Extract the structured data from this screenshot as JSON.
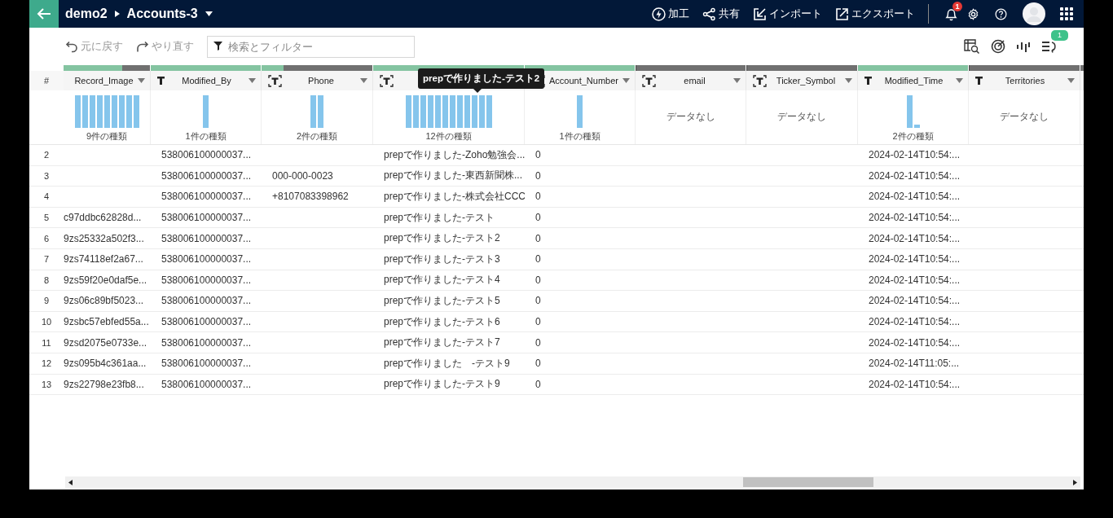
{
  "header": {
    "workspace": "demo2",
    "dataset": "Accounts-3",
    "actions": [
      {
        "kind": "bolt",
        "label": "加工"
      },
      {
        "kind": "share",
        "label": "共有"
      },
      {
        "kind": "import",
        "label": "インポート"
      },
      {
        "kind": "export",
        "label": "エクスポート"
      }
    ],
    "notification_count": "1"
  },
  "toolbar": {
    "undo": {
      "label": "元に戻す",
      "disabled": true
    },
    "redo": {
      "label": "やり直す",
      "disabled": true
    },
    "search": {
      "placeholder": "検索とフィルター"
    },
    "rules_count": "1"
  },
  "tooltip": "prepで作りました-テスト2",
  "table": {
    "number_header": "#",
    "columns": [
      {
        "label": "Record_Image",
        "kind": "none",
        "level": 0.68,
        "profile": {
          "kind": "histogram",
          "summary": "9件の種類",
          "bars": [
            {
              "kind": "tall"
            },
            {
              "kind": "tall"
            },
            {
              "kind": "tall"
            },
            {
              "kind": "tall"
            },
            {
              "kind": "tall"
            },
            {
              "kind": "tall"
            },
            {
              "kind": "tall"
            },
            {
              "kind": "tall"
            },
            {
              "kind": "tall"
            }
          ]
        }
      },
      {
        "label": "Modified_By",
        "kind": "plain",
        "level": 1,
        "profile": {
          "kind": "histogram",
          "summary": "1件の種類",
          "bars": [
            {
              "kind": "tall"
            }
          ]
        }
      },
      {
        "label": "Phone",
        "kind": "bracket",
        "level": 0.2,
        "profile": {
          "kind": "histogram",
          "summary": "2件の種類",
          "bars": [
            {
              "kind": "tall"
            },
            {
              "kind": "tall"
            }
          ]
        }
      },
      {
        "kind": "bracket",
        "level": 1,
        "profile": {
          "kind": "histogram",
          "summary": "12件の種類",
          "bars": [
            {
              "kind": "tall"
            },
            {
              "kind": "tall"
            },
            {
              "kind": "tall"
            },
            {
              "kind": "tall"
            },
            {
              "kind": "tall"
            },
            {
              "kind": "tall"
            },
            {
              "kind": "tall"
            },
            {
              "kind": "tall"
            },
            {
              "kind": "tall"
            },
            {
              "kind": "tall"
            },
            {
              "kind": "tall"
            },
            {
              "kind": "tall"
            }
          ]
        }
      },
      {
        "label": "Account_Number",
        "kind": "bracket",
        "level": 1,
        "profile": {
          "kind": "histogram",
          "summary": "1件の種類",
          "bars": [
            {
              "kind": "tall"
            }
          ]
        }
      },
      {
        "label": "email",
        "kind": "bracket",
        "level": 0,
        "profile": {
          "kind": "empty",
          "summary": "データなし"
        }
      },
      {
        "label": "Ticker_Symbol",
        "kind": "bracket",
        "level": 0,
        "profile": {
          "kind": "empty",
          "summary": "データなし"
        }
      },
      {
        "label": "Modified_Time",
        "kind": "plain",
        "level": 1,
        "profile": {
          "kind": "histogram",
          "summary": "2件の種類",
          "bars": [
            {
              "kind": "tall"
            },
            {
              "kind": "short"
            }
          ]
        }
      },
      {
        "label": "Territories",
        "kind": "plain",
        "level": 0,
        "profile": {
          "kind": "empty",
          "summary": "データなし"
        }
      }
    ],
    "rows": [
      {
        "number": "2",
        "cells": [
          null,
          "538006100000037...",
          null,
          "prepで作りました-Zoho勉強会...",
          "0",
          null,
          null,
          "2024-02-14T10:54:...",
          null
        ]
      },
      {
        "number": "3",
        "cells": [
          null,
          "538006100000037...",
          "000-000-0023",
          "prepで作りました-東西新聞株...",
          "0",
          null,
          null,
          "2024-02-14T10:54:...",
          null
        ]
      },
      {
        "number": "4",
        "cells": [
          null,
          "538006100000037...",
          "+8107083398962",
          "prepで作りました-株式会社CCC",
          "0",
          null,
          null,
          "2024-02-14T10:54:...",
          null
        ]
      },
      {
        "number": "5",
        "cells": [
          "c97ddbc62828d...",
          "538006100000037...",
          null,
          "prepで作りました-テスト",
          "0",
          null,
          null,
          "2024-02-14T10:54:...",
          null
        ]
      },
      {
        "number": "6",
        "cells": [
          "9zs25332a502f3...",
          "538006100000037...",
          null,
          "prepで作りました-テスト2",
          "0",
          null,
          null,
          "2024-02-14T10:54:...",
          null
        ]
      },
      {
        "number": "7",
        "cells": [
          "9zs74118ef2a67...",
          "538006100000037...",
          null,
          "prepで作りました-テスト3",
          "0",
          null,
          null,
          "2024-02-14T10:54:...",
          null
        ]
      },
      {
        "number": "8",
        "cells": [
          "9zs59f20e0daf5e...",
          "538006100000037...",
          null,
          "prepで作りました-テスト4",
          "0",
          null,
          null,
          "2024-02-14T10:54:...",
          null
        ]
      },
      {
        "number": "9",
        "cells": [
          "9zs06c89bf5023...",
          "538006100000037...",
          null,
          "prepで作りました-テスト5",
          "0",
          null,
          null,
          "2024-02-14T10:54:...",
          null
        ]
      },
      {
        "number": "10",
        "cells": [
          "9zsbc57ebfed55a...",
          "538006100000037...",
          null,
          "prepで作りました-テスト6",
          "0",
          null,
          null,
          "2024-02-14T10:54:...",
          null
        ]
      },
      {
        "number": "11",
        "cells": [
          "9zsd2075e0733e...",
          "538006100000037...",
          null,
          "prepで作りました-テスト7",
          "0",
          null,
          null,
          "2024-02-14T10:54:...",
          null
        ]
      },
      {
        "number": "12",
        "cells": [
          "9zs095b4c361aa...",
          "538006100000037...",
          null,
          "prepで作りました　-テスト9",
          "0",
          null,
          null,
          "2024-02-14T11:05:...",
          null
        ]
      },
      {
        "number": "13",
        "cells": [
          "9zs22798e23fb8...",
          "538006100000037...",
          null,
          "prepで作りました-テスト9",
          "0",
          null,
          null,
          "2024-02-14T10:54:...",
          null
        ]
      }
    ]
  }
}
